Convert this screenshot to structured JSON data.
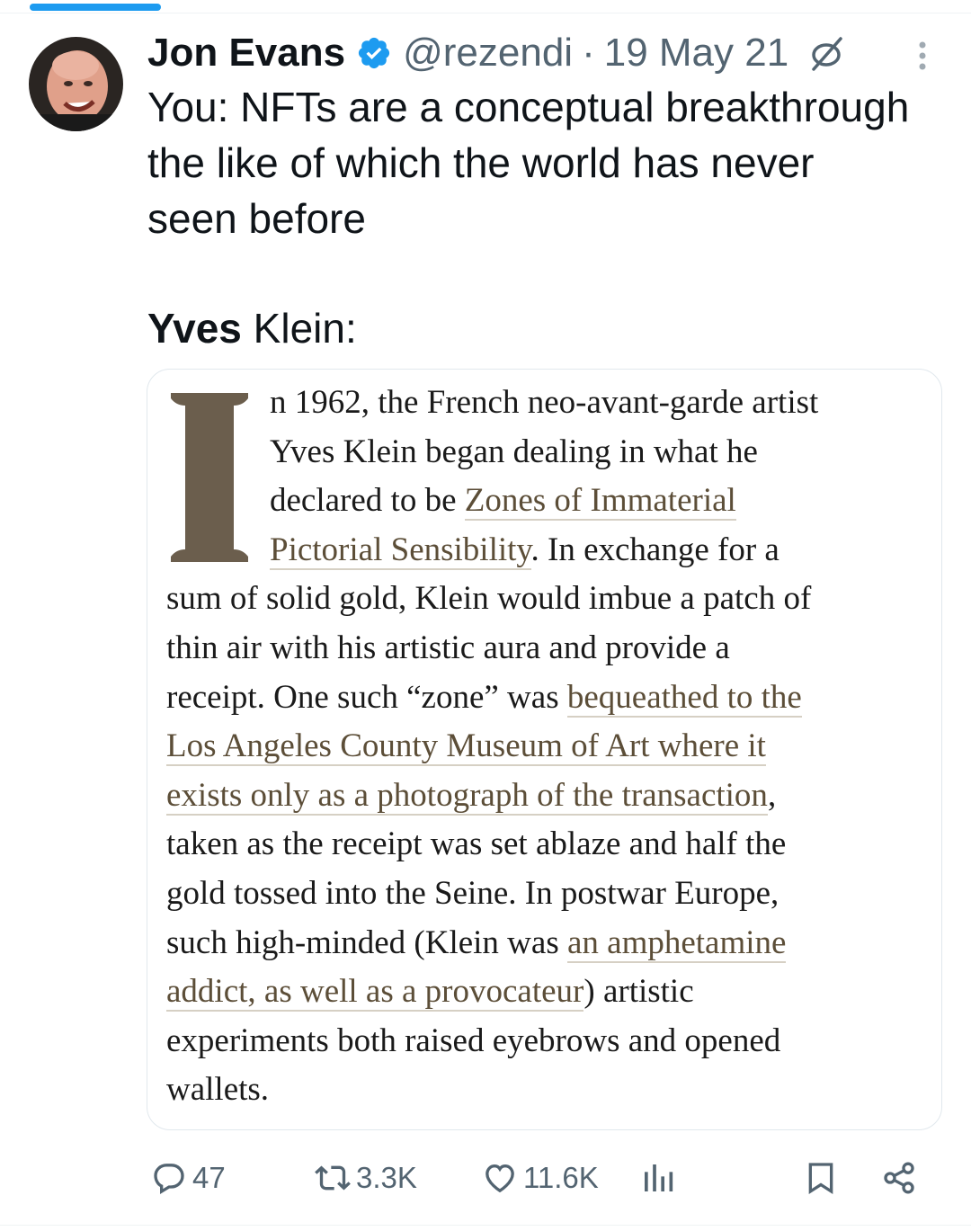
{
  "tweet": {
    "author_name": "Jon Evans",
    "handle": "@rezendi",
    "separator": "·",
    "date": "19 May 21",
    "text_lines": [
      "You: NFTs are a conceptual breakthrough",
      "the like of which the world has never",
      "seen before"
    ],
    "second_line_bold": "Yves",
    "second_line_rest": " Klein:"
  },
  "article": {
    "dropcap": "I",
    "lines": [
      [
        {
          "t": "n 1962, the French neo-avant-garde artist",
          "link": false
        }
      ],
      [
        {
          "t": "Yves Klein began dealing in what he",
          "link": false
        }
      ],
      [
        {
          "t": "declared to be ",
          "link": false
        },
        {
          "t": "Zones of Immaterial",
          "link": true
        }
      ],
      [
        {
          "t": "Pictorial Sensibility",
          "link": true
        },
        {
          "t": ". In exchange for a",
          "link": false
        }
      ],
      [
        {
          "t": "sum of solid gold, Klein would imbue a patch of",
          "link": false
        }
      ],
      [
        {
          "t": "thin air with his artistic aura and provide a",
          "link": false
        }
      ],
      [
        {
          "t": "receipt. One such “zone” was ",
          "link": false
        },
        {
          "t": "bequeathed to the",
          "link": true
        }
      ],
      [
        {
          "t": "Los Angeles County Museum of Art where it",
          "link": true
        }
      ],
      [
        {
          "t": "exists only as a photograph of the transaction",
          "link": true
        },
        {
          "t": ",",
          "link": false
        }
      ],
      [
        {
          "t": "taken as the receipt was set ablaze and half the",
          "link": false
        }
      ],
      [
        {
          "t": "gold tossed into the Seine. In postwar Europe,",
          "link": false
        }
      ],
      [
        {
          "t": "such high-minded (Klein was ",
          "link": false
        },
        {
          "t": "an amphetamine",
          "link": true
        }
      ],
      [
        {
          "t": "addict, as well as a provocateur",
          "link": true
        },
        {
          "t": ") artistic",
          "link": false
        }
      ],
      [
        {
          "t": "experiments both raised eyebrows and opened",
          "link": false
        }
      ],
      [
        {
          "t": "wallets.",
          "link": false
        }
      ]
    ]
  },
  "actions": {
    "replies": "47",
    "retweets": "3.3K",
    "likes": "11.6K"
  },
  "icons": {
    "verified": "verified-badge-icon",
    "no_edit": "edit-disabled-icon",
    "more": "more-vertical-icon",
    "reply": "reply-icon",
    "retweet": "retweet-icon",
    "like": "heart-icon",
    "views": "views-icon",
    "bookmark": "bookmark-icon",
    "share": "share-icon"
  },
  "colors": {
    "accent": "#1d9bf0",
    "text": "#0f1419",
    "secondary": "#536471",
    "link": "#5c4e38",
    "dropcap": "#6b5e4d"
  }
}
